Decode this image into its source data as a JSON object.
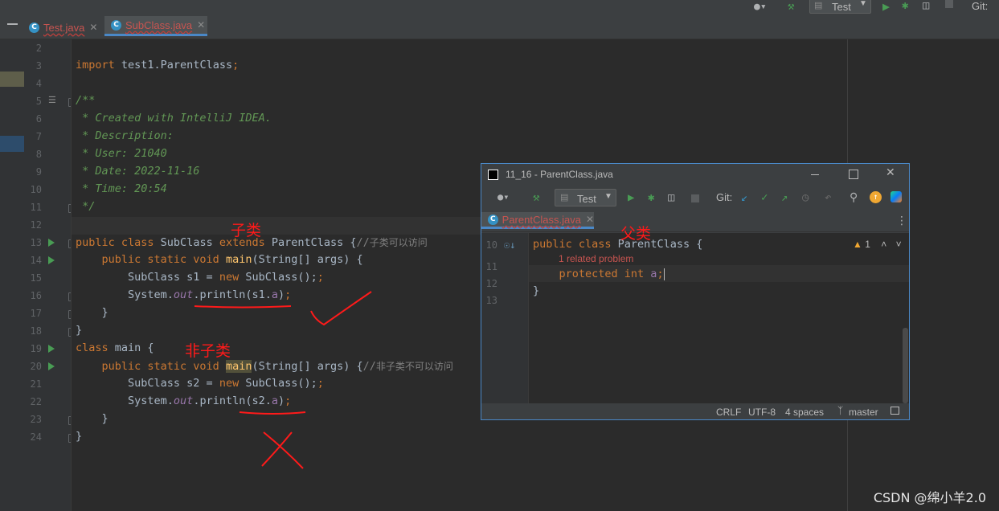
{
  "topbar": {
    "run_config": "Test",
    "git_label": "Git:"
  },
  "tabs": [
    {
      "label": "Test.java",
      "active": false
    },
    {
      "label": "SubClass.java",
      "active": true
    }
  ],
  "editor": {
    "lines": [
      {
        "n": "2"
      },
      {
        "n": "3"
      },
      {
        "n": "4"
      },
      {
        "n": "5"
      },
      {
        "n": "6"
      },
      {
        "n": "7"
      },
      {
        "n": "8"
      },
      {
        "n": "9"
      },
      {
        "n": "10"
      },
      {
        "n": "11"
      },
      {
        "n": "12"
      },
      {
        "n": "13"
      },
      {
        "n": "14"
      },
      {
        "n": "15"
      },
      {
        "n": "16"
      },
      {
        "n": "17"
      },
      {
        "n": "18"
      },
      {
        "n": "19"
      },
      {
        "n": "20"
      },
      {
        "n": "21"
      },
      {
        "n": "22"
      },
      {
        "n": "23"
      },
      {
        "n": "24"
      }
    ],
    "code": {
      "import_kw": "import",
      "import_path": " test1.ParentClass",
      "semi": ";",
      "doc_open": "/**",
      "doc_created": " * Created with IntelliJ IDEA.",
      "doc_desc": " * Description:",
      "doc_user": " * User: 21040",
      "doc_date": " * Date: 2022-11-16",
      "doc_time": " * Time: 20:54",
      "doc_close": " */",
      "l13_kw": "public class",
      "l13_name": " SubClass ",
      "l13_extends": "extends",
      "l13_parent": " ParentClass {",
      "l13_comment_prefix": "//",
      "l13_comment_zh": "子类可以访问",
      "main_kw": "    public static void",
      "main_name": "main",
      "main_args": "(String[] args) {",
      "l15_pre": "        SubClass s1 = ",
      "new_kw": "new",
      "l15_post": " SubClass();",
      "sysout_pre": "        System.",
      "sysout_out": "out",
      "sysout_println": ".println(",
      "l16_var": "s1.",
      "field_a": "a",
      "close_paren": ")",
      "close_brace_inner": "    }",
      "close_brace": "}",
      "l19_kw": "class",
      "l19_rest": " main {",
      "l20_comment_zh": "非子类不可以访问",
      "l21_pre": "        SubClass s2 = ",
      "l22_var": "s2."
    }
  },
  "annotations": {
    "subclass": "子类",
    "non_subclass": "非子类",
    "parent": "父类"
  },
  "popup": {
    "title": "11_16 - ParentClass.java",
    "run_config": "Test",
    "git_label": "Git:",
    "tab_label": "ParentClass.java",
    "problem_count": "1",
    "related_problem": "1 related problem",
    "lines": [
      {
        "n": "10"
      },
      {
        "n": "11"
      },
      {
        "n": "12"
      },
      {
        "n": "13"
      }
    ],
    "code": {
      "l10_kw": "public class",
      "l10_rest": " ParentClass {",
      "l11_kw": "    protected int",
      "l11_field": " a",
      "l11_semi": ";",
      "l12": "}"
    },
    "status": {
      "line_sep": "CRLF",
      "encoding": "UTF-8",
      "indent": "4 spaces",
      "branch": "master"
    }
  },
  "watermark": "CSDN @绵小羊2.0",
  "colors": {
    "accent": "#4a88c7",
    "keyword": "#cc7832",
    "comment": "#629755",
    "annotation": "#ff1a1a"
  }
}
